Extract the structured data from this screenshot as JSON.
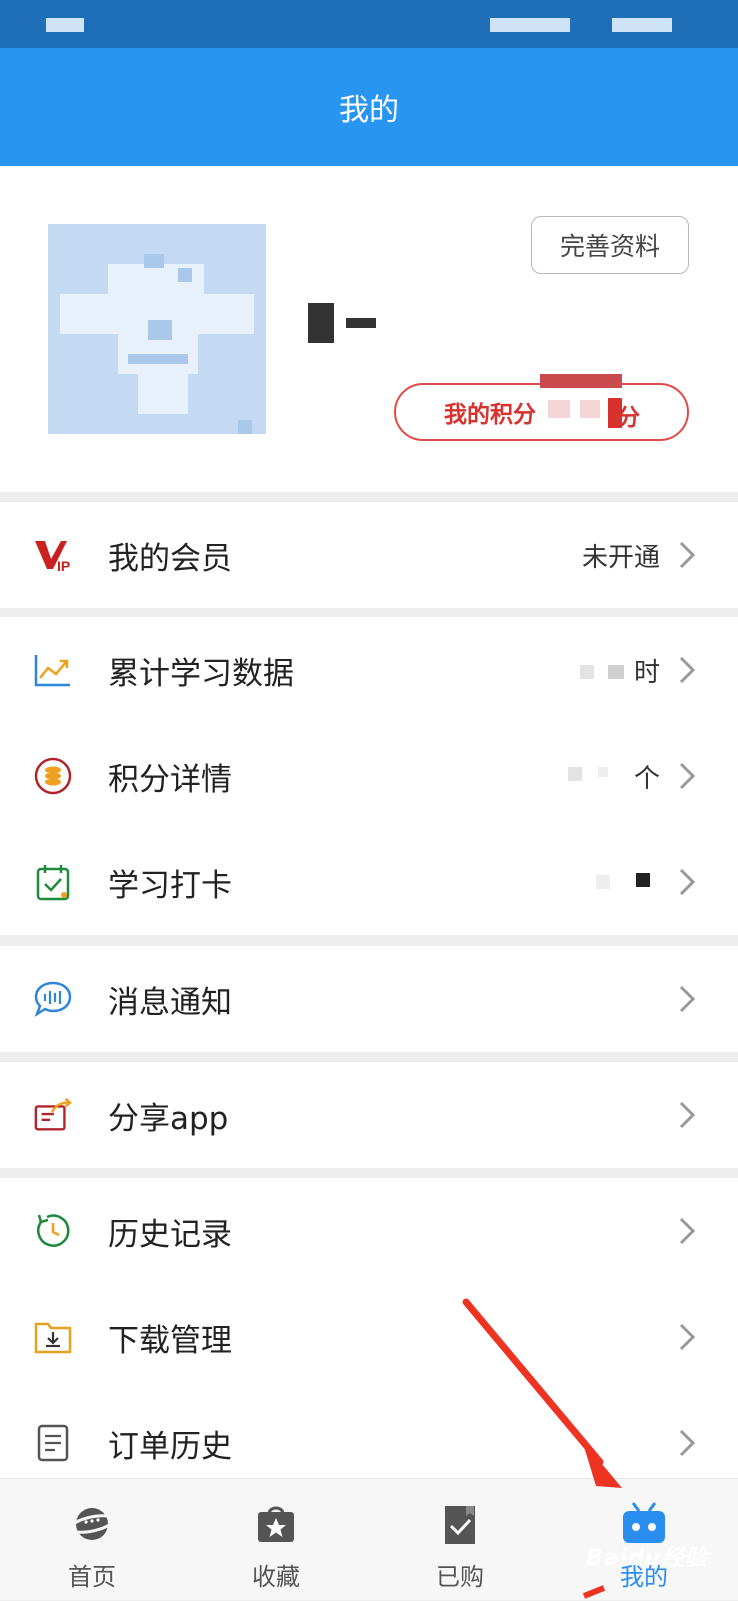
{
  "header": {
    "title": "我的"
  },
  "profile": {
    "edit_label": "完善资料",
    "points_label": "我的积分",
    "points_suffix": "分"
  },
  "menu": {
    "vip": {
      "label": "我的会员",
      "value": "未开通"
    },
    "study_data": {
      "label": "累计学习数据",
      "value": "时"
    },
    "points_detail": {
      "label": "积分详情",
      "value": "个"
    },
    "checkin": {
      "label": "学习打卡"
    },
    "messages": {
      "label": "消息通知"
    },
    "share": {
      "label": "分享app"
    },
    "history": {
      "label": "历史记录"
    },
    "downloads": {
      "label": "下载管理"
    },
    "orders": {
      "label": "订单历史"
    }
  },
  "tabbar": {
    "home": "首页",
    "favorites": "收藏",
    "purchased": "已购",
    "mine": "我的"
  },
  "watermark": "Baidu经验",
  "colors": {
    "header_bg": "#2896f0",
    "accent_red": "#d8322f",
    "tab_active": "#2a8ef0"
  }
}
